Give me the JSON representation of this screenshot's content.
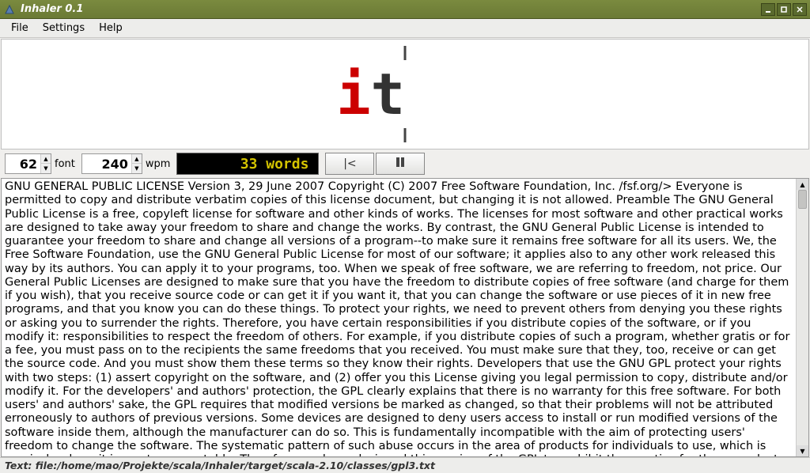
{
  "window": {
    "title": "Inhaler 0.1"
  },
  "menu": {
    "file": "File",
    "settings": "Settings",
    "help": "Help"
  },
  "reader": {
    "pivot_char": "i",
    "rest_chars": "t"
  },
  "controls": {
    "font_size": "62",
    "font_label": "font",
    "wpm": "240",
    "wpm_label": "wpm",
    "word_counter": "33 words"
  },
  "text_body": "GNU GENERAL PUBLIC LICENSE Version 3, 29 June 2007 Copyright (C) 2007 Free Software Foundation, Inc. /fsf.org/> Everyone is permitted to copy and distribute verbatim copies of this license document, but changing it is not allowed. Preamble The GNU General Public License is a free, copyleft license for software and other kinds of works. The licenses for most software and other practical works are designed to take away your freedom to share and change the works. By contrast, the GNU General Public License is intended to guarantee your freedom to share and change all versions of a program--to make sure it remains free software for all its users. We, the Free Software Foundation, use the GNU General Public License for most of our software; it applies also to any other work released this way by its authors. You can apply it to your programs, too. When we speak of free software, we are referring to freedom, not price. Our General Public Licenses are designed to make sure that you have the freedom to distribute copies of free software (and charge for them if you wish), that you receive source code or can get it if you want it, that you can change the software or use pieces of it in new free programs, and that you know you can do these things. To protect your rights, we need to prevent others from denying you these rights or asking you to surrender the rights. Therefore, you have certain responsibilities if you distribute copies of the software, or if you modify it: responsibilities to respect the freedom of others. For example, if you distribute copies of such a program, whether gratis or for a fee, you must pass on to the recipients the same freedoms that you received. You must make sure that they, too, receive or can get the source code. And you must show them these terms so they know their rights. Developers that use the GNU GPL protect your rights with two steps: (1) assert copyright on the software, and (2) offer you this License giving you legal permission to copy, distribute and/or modify it. For the developers' and authors' protection, the GPL clearly explains that there is no warranty for this free software. For both users' and authors' sake, the GPL requires that modified versions be marked as changed, so that their problems will not be attributed erroneously to authors of previous versions. Some devices are designed to deny users access to install or run modified versions of the software inside them, although the manufacturer can do so. This is fundamentally incompatible with the aim of protecting users' freedom to change the software. The systematic pattern of such abuse occurs in the area of products for individuals to use, which is precisely where it is most unacceptable. Therefore, we have designed this version of the GPL to prohibit the practice for those products. If such problems arise substantially in other domains, we stand ready to extend this provision to those",
  "status": {
    "text": "Text: file:/home/mao/Projekte/scala/Inhaler/target/scala-2.10/classes/gpl3.txt"
  }
}
